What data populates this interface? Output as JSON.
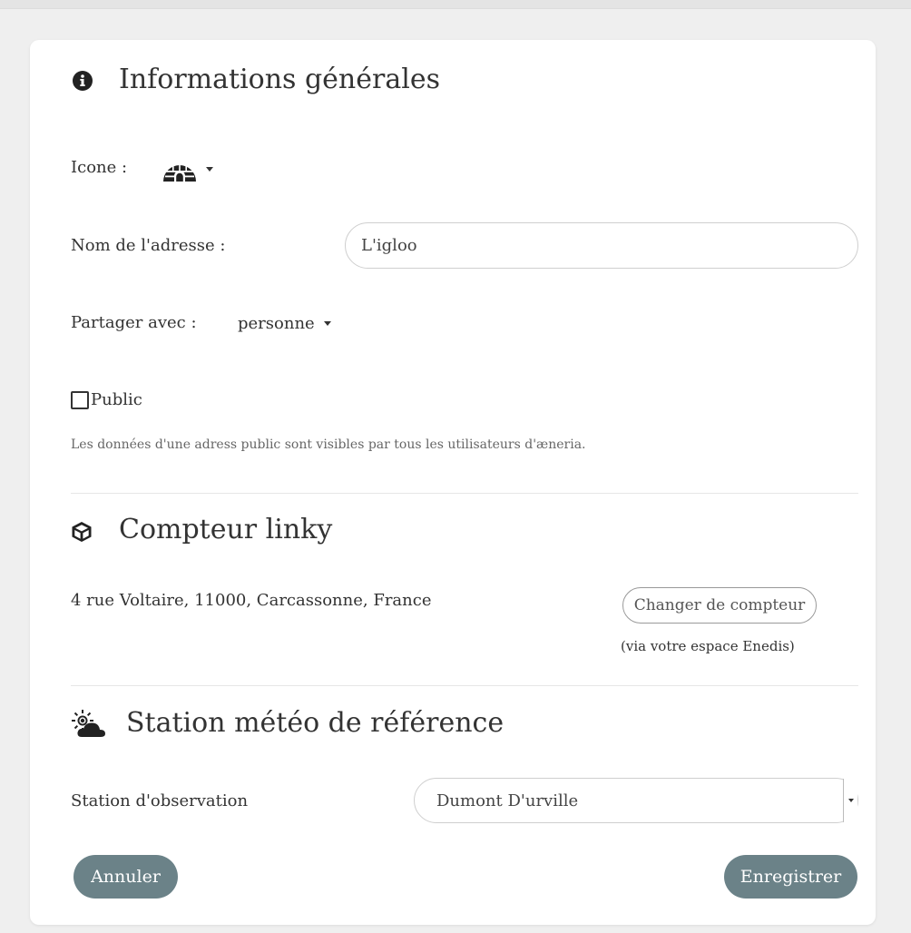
{
  "general": {
    "title": "Informations générales",
    "title_icon": "info-circle-icon",
    "icon_label": "Icone :",
    "selected_icon": "igloo-icon",
    "name_label": "Nom de l'adresse :",
    "name_value": "L'igloo",
    "share_label": "Partager avec :",
    "share_value": "personne",
    "public_label": "Public",
    "public_checked": false,
    "public_help": "Les données d'une adress public sont visibles par tous les utilisateurs d'æneria."
  },
  "meter": {
    "title": "Compteur linky",
    "title_icon": "cube-icon",
    "address": "4 rue Voltaire, 11000, Carcassonne, France",
    "change_button": "Changer de compteur",
    "change_hint": "(via votre espace Enedis)"
  },
  "weather": {
    "title": "Station météo de référence",
    "title_icon": "cloud-sun-icon",
    "station_label": "Station d'observation",
    "station_value": "Dumont D'urville"
  },
  "actions": {
    "cancel": "Annuler",
    "save": "Enregistrer"
  },
  "colors": {
    "primary_button": "#6b8288",
    "background": "#efefef",
    "card": "#ffffff"
  }
}
